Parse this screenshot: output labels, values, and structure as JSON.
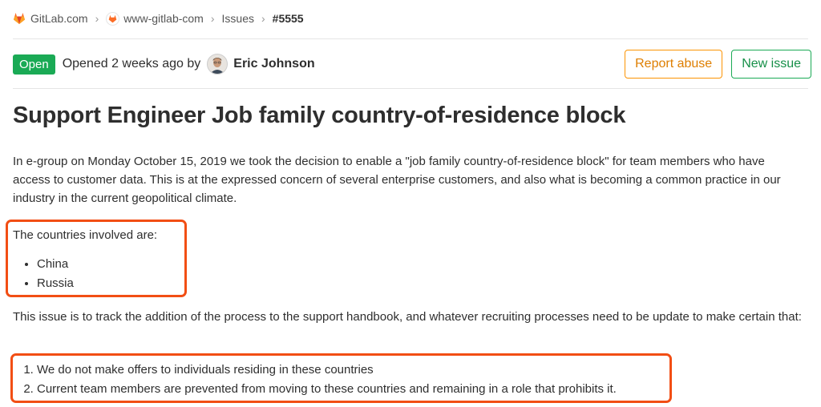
{
  "breadcrumb": {
    "items": [
      {
        "label": "GitLab.com"
      },
      {
        "label": "www-gitlab-com"
      },
      {
        "label": "Issues"
      },
      {
        "label": "#5555"
      }
    ]
  },
  "issue": {
    "status": "Open",
    "opened_text": "Opened 2 weeks ago by",
    "author": "Eric Johnson",
    "title": "Support Engineer Job family country-of-residence block",
    "paragraphs": [
      "In e-group on Monday October 15, 2019 we took the decision to enable a \"job family country-of-residence block\" for team members who have access to customer data. This is at the expressed concern of several enterprise customers, and also what is becoming a common practice in our industry in the current geopolitical climate.",
      "The countries involved are:",
      "This issue is to track the addition of the process to the support handbook, and whatever recruiting processes need to be update to make certain that:"
    ],
    "countries": [
      "China",
      "Russia"
    ],
    "requirements": [
      "We do not make offers to individuals residing in these countries",
      "Current team members are prevented from moving to these countries and remaining in a role that prohibits it."
    ]
  },
  "actions": {
    "report_abuse": "Report abuse",
    "new_issue": "New issue"
  },
  "colors": {
    "status_open": "#1aaa55",
    "report_abuse_border": "#fc9403",
    "new_issue_border": "#1aaa55",
    "highlight": "#f24e14"
  },
  "icons": {
    "group": "gitlab-tanuki-icon",
    "project": "project-avatar-icon"
  }
}
